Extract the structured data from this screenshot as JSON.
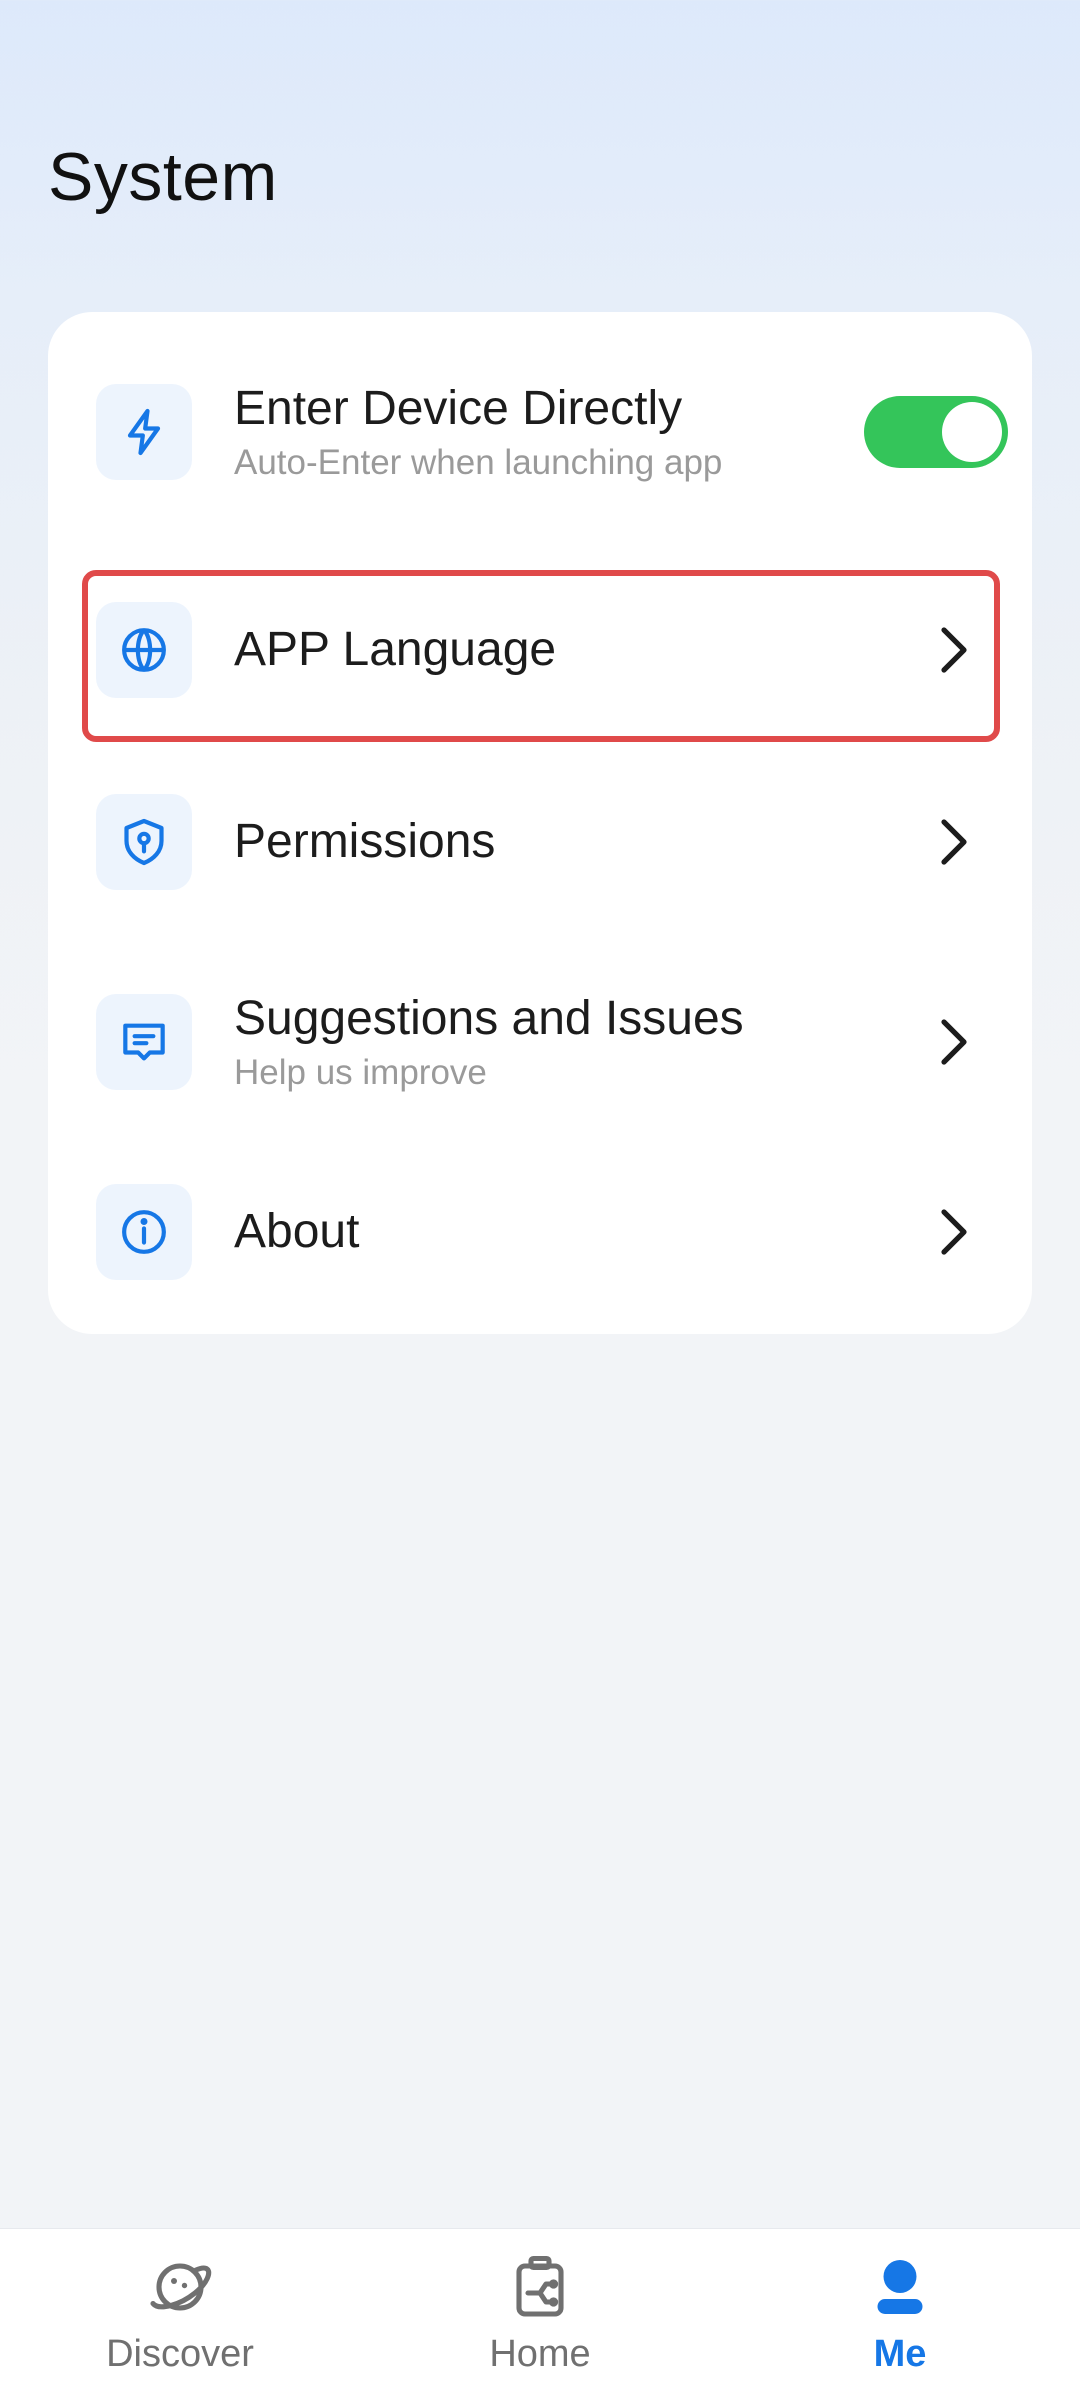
{
  "header": {
    "title": "System"
  },
  "settings": {
    "items": [
      {
        "title": "Enter Device Directly",
        "subtitle": "Auto-Enter when launching app",
        "icon": "lightning-icon",
        "toggle_on": true
      },
      {
        "title": "APP Language",
        "icon": "globe-icon",
        "highlighted": true
      },
      {
        "title": "Permissions",
        "icon": "shield-lock-icon"
      },
      {
        "title": "Suggestions and Issues",
        "subtitle": "Help us improve",
        "icon": "message-icon"
      },
      {
        "title": "About",
        "icon": "info-icon"
      }
    ]
  },
  "nav": {
    "items": [
      {
        "label": "Discover",
        "icon": "planet-icon",
        "active": false
      },
      {
        "label": "Home",
        "icon": "device-icon",
        "active": false
      },
      {
        "label": "Me",
        "icon": "person-icon",
        "active": true
      }
    ]
  },
  "colors": {
    "accent": "#1677e6",
    "toggle_on": "#34c55a",
    "highlight": "#e04a4a"
  }
}
